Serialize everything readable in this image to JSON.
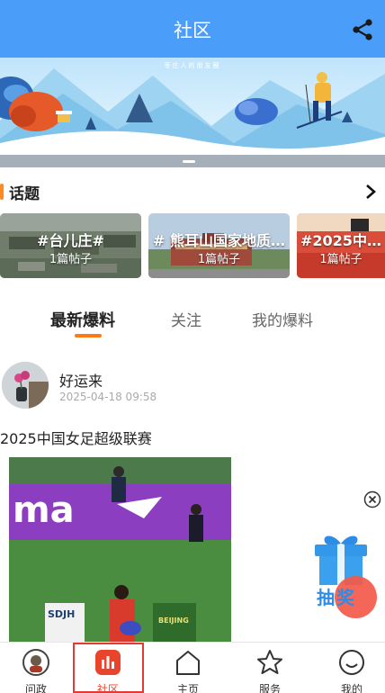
{
  "header": {
    "title": "社区"
  },
  "banner": {
    "tagline": "枣庄人的朋友圈"
  },
  "topics": {
    "label": "话题",
    "items": [
      {
        "name": "#台儿庄#",
        "count": "1篇帖子"
      },
      {
        "name": "# 熊耳山国家地质…",
        "count": "1篇帖子"
      },
      {
        "name": "#2025中国…",
        "count": "1篇帖子"
      }
    ]
  },
  "tabs": [
    {
      "label": "最新爆料"
    },
    {
      "label": "关注"
    },
    {
      "label": "我的爆料"
    }
  ],
  "post": {
    "author": "好运来",
    "time": "2025-04-18 09:58",
    "title": "2025中国女足超级联赛",
    "image_text": {
      "sponsor": "ma",
      "team1": "SDJH",
      "team2": "BEIJING"
    }
  },
  "floating": {
    "gift_label": "抽奖"
  },
  "tabbar": [
    {
      "label": "问政"
    },
    {
      "label": "社区"
    },
    {
      "label": "主页"
    },
    {
      "label": "服务"
    },
    {
      "label": "我的"
    }
  ],
  "colors": {
    "brand_blue": "#4a9df8",
    "accent_orange": "#ff7a12",
    "active_red": "#e8452c"
  },
  "icons": {
    "header": "share-icon",
    "topics": "chevron-right-icon",
    "floating": [
      "close-circle-icon",
      "gift-icon"
    ],
    "tabbar": [
      "avatar-badge-icon",
      "bar-chart-icon",
      "home-icon",
      "star-icon",
      "smile-icon"
    ]
  }
}
